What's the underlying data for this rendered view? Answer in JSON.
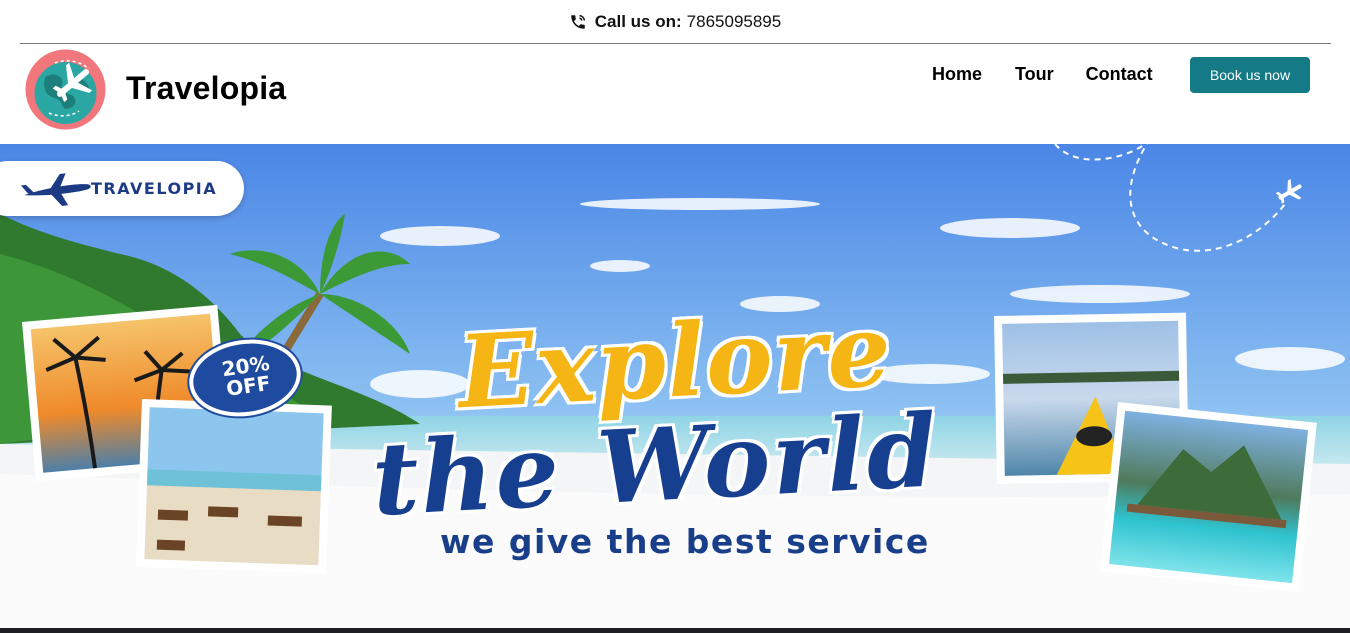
{
  "topbar": {
    "call_label": "Call us on:",
    "phone_number": "7865095895",
    "icon": "phone-icon"
  },
  "header": {
    "brand_name": "Travelopia",
    "logo_icon": "globe-airplane-icon",
    "nav": [
      {
        "label": "Home"
      },
      {
        "label": "Tour"
      },
      {
        "label": "Contact"
      }
    ],
    "cta_label": "Book us now",
    "cta_color": "#137a86"
  },
  "hero": {
    "logo_text": "TRAVELOPIA",
    "badge": {
      "line1": "20%",
      "line2": "OFF"
    },
    "headline_line1": "Explore",
    "headline_line2": "the World",
    "tagline": "we give the best service",
    "colors": {
      "headline_yellow": "#f5b514",
      "headline_blue": "#173f8f",
      "sky": "#4b8fe0"
    }
  }
}
